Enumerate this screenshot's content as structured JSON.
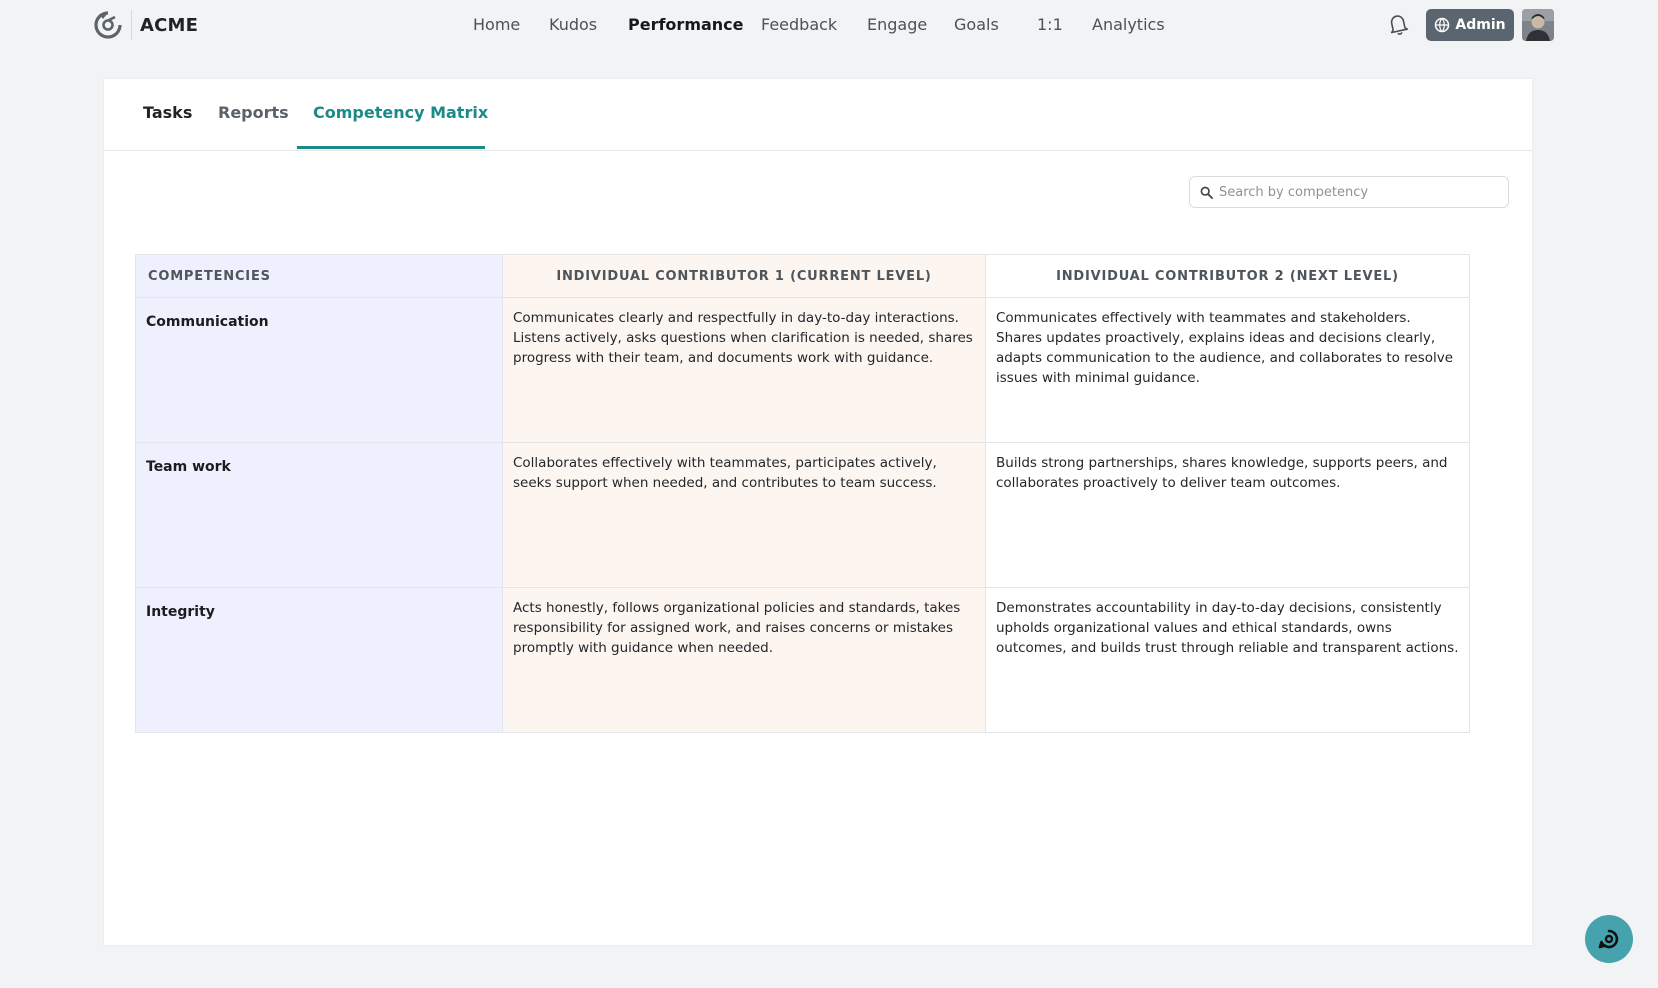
{
  "brand": {
    "name": "ACME"
  },
  "nav": {
    "items": [
      {
        "label": "Home"
      },
      {
        "label": "Kudos"
      },
      {
        "label": "Performance",
        "active": true
      },
      {
        "label": "Feedback"
      },
      {
        "label": "Engage"
      },
      {
        "label": "Goals"
      },
      {
        "label": "1:1"
      },
      {
        "label": "Analytics"
      }
    ]
  },
  "header": {
    "admin_label": "Admin",
    "icons": [
      "bell-icon",
      "globe-icon",
      "avatar"
    ]
  },
  "tabs": [
    {
      "label": "Tasks"
    },
    {
      "label": "Reports"
    },
    {
      "label": "Competency Matrix",
      "active": true
    }
  ],
  "search": {
    "placeholder": "Search by competency",
    "value": ""
  },
  "matrix": {
    "headers": [
      "COMPETENCIES",
      "INDIVIDUAL CONTRIBUTOR 1 (CURRENT LEVEL)",
      "INDIVIDUAL CONTRIBUTOR 2 (NEXT LEVEL)"
    ],
    "rows": [
      {
        "name": "Communication",
        "current": "Communicates clearly and respectfully in day-to-day interactions. Listens actively, asks questions when clarification is needed, shares progress with their team, and documents work with guidance.",
        "next": "Communicates effectively with teammates and stakeholders. Shares updates proactively, explains ideas and decisions clearly, adapts communication to the audience, and collaborates to resolve issues with minimal guidance."
      },
      {
        "name": "Team work",
        "current": "Collaborates effectively with teammates, participates actively, seeks support when needed, and contributes to team success.",
        "next": "Builds strong partnerships, shares knowledge, supports peers, and collaborates proactively to deliver team outcomes."
      },
      {
        "name": "Integrity",
        "current": "Acts honestly, follows organizational policies and standards, takes responsibility for assigned work, and raises concerns or mistakes promptly with guidance when needed.",
        "next": "Demonstrates accountability in day-to-day decisions, consistently upholds organizational values and ethical standards, owns outcomes, and builds trust through reliable and transparent actions."
      }
    ]
  },
  "colors": {
    "accent": "#1d8a8a",
    "competency_column": "#eff0fd",
    "current_level_column": "#fdf5f0",
    "admin_button": "#5b6570",
    "help_fab": "#46a3ad"
  }
}
